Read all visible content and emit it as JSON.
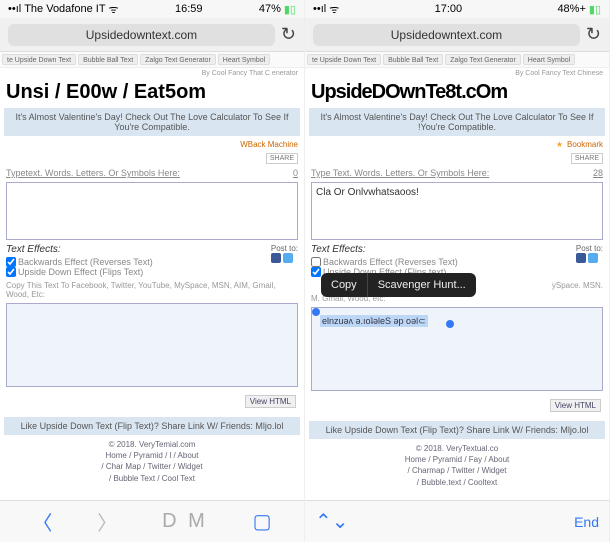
{
  "left": {
    "status": {
      "carrier": "The Vodafone IT",
      "time": "16:59",
      "battery": "47%"
    },
    "url": "Upsidedowntext.com",
    "tabs": [
      "te Upside Down Text",
      "Bubble Ball Text",
      "Zalgo Text Generator",
      "Heart Symbol"
    ],
    "byline": "By Cool Fancy That C enerator",
    "title": "Unsi / E00w / Eat5om",
    "valentine": "It's Almost Valentine's Day! Check Out The Love Calculator To See If You're Compatible.",
    "bookmark": "WBack Machine",
    "share": "SHARE",
    "prompt": "Typetext. Words. Letters. Or Symbols Here:",
    "count": "0",
    "input": "",
    "effects_title": "Text Effects:",
    "effect1": "Backwards Effect (Reverses Text)",
    "effect2": "Upside Down Effect (Flips Text)",
    "postto": "Post to:",
    "copyline": "Copy This Text To Facebook, Twitter, YouTube, MySpace, MSN, AIM, Gmail, Wood, Etc:",
    "viewhtml": "View HTML",
    "footer_like": "Like Upside Down Text (Flip Text)? Share Link W/ Friends: Mljo.lol",
    "copyright": "© 2018. VeryTemial.com",
    "footer1": "Home / Pyramid / l / About",
    "footer2": "/ Char Map / Twitter / Widget",
    "footer3": "/ Bubble Text / Cool Text",
    "dm": "D M"
  },
  "right": {
    "status": {
      "carrier": "",
      "time": "17:00",
      "battery": "48%+"
    },
    "url": "Upsidedowntext.com",
    "tabs": [
      "te Upside Down Text",
      "Bubble Ball Text",
      "Zalgo Text Generator",
      "Heart Symbol"
    ],
    "byline": "By Cool Fancy Text Chinese",
    "title": "UpsideDOwnTe8t.cOm",
    "valentine": "It's Almost Valentine's Day! Check Out The Love Calculator To See If !You're Compatible.",
    "bookmark": "Bookmark",
    "share": "SHARE",
    "prompt": "Type Text. Words. Letters. Or Symbols Here:",
    "count": "28",
    "input": "Cla  Or Onlvwhatsaoos!",
    "effects_title": "Text Effects:",
    "effect1": "Backwards Effect (Reverses Text)",
    "effect2": "Upside Down Effect (Flips text)",
    "postto": "Post to:",
    "menu_copy": "Copy",
    "menu_scav": "Scavenger Hunt...",
    "copyline_tail": "ySpace. MSN.",
    "copyline2": "M. Gmail, Wood, etc:",
    "output_sel": "elnzuəʌ ə.ıoʇəleS əp oəl⊂",
    "viewhtml": "View HTML",
    "footer_like": "Like Upside Down Text (Flip Text)? Share Link W/ Friends: Mljo.lol",
    "copyright": "© 2018. VeryTextual.co",
    "footer1": "Home / Pyramid / Fay / About",
    "footer2": "/ Charmap / Twitter / Widget",
    "footer3": "/ Bubble.text / Cooltext",
    "done": "End"
  }
}
